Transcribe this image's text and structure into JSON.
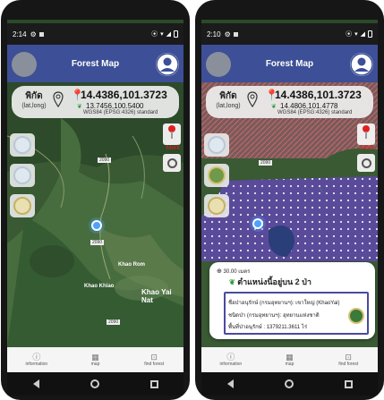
{
  "left_phone": {
    "status": {
      "time": "2:14"
    },
    "appbar": {
      "title": "Forest Map"
    },
    "coords": {
      "label": "พิกัด",
      "label_sub": "(lat,long)",
      "main": "14.4386,101.3723",
      "secondary": "13.7456,100.5400",
      "crs": "WGS84 (EPSG:4326) standard"
    },
    "mark_label": "Mark",
    "map_labels": {
      "road_1": "2090",
      "road_2": "2090",
      "road_3": "2090",
      "place_1": "Khao Rom",
      "place_2": "Khao Khiao",
      "place_3": "Khao Yai Nat"
    },
    "nav": {
      "info": "information",
      "map": "map",
      "find": "find forest"
    }
  },
  "right_phone": {
    "status": {
      "time": "2:10"
    },
    "appbar": {
      "title": "Forest Map"
    },
    "coords": {
      "label": "พิกัด",
      "label_sub": "(lat,long)",
      "main": "14.4386,101.3723",
      "secondary": "14.4806,101.4778",
      "crs": "WGS84 (EPSG:4326) standard"
    },
    "mark_label": "Mark",
    "map_labels": {
      "road_1": "2090"
    },
    "popup": {
      "distance": "30.00 เมตร",
      "forest_count": "ตำแหน่งนี้อยู่บน 2 ป่า",
      "line_1": "ชื่อป่าอนุรักษ์ (กรมอุทยานฯ): เขาใหญ่ (KhaoYai)",
      "line_2": "ชนิดป่า (กรมอุทยานฯ): อุทยานแห่งชาติ",
      "line_3": "พื้นที่ป่าอนุรักษ์ : 1379211.3611 ไร่"
    },
    "nav": {
      "info": "information",
      "map": "map",
      "find": "find forest"
    }
  }
}
